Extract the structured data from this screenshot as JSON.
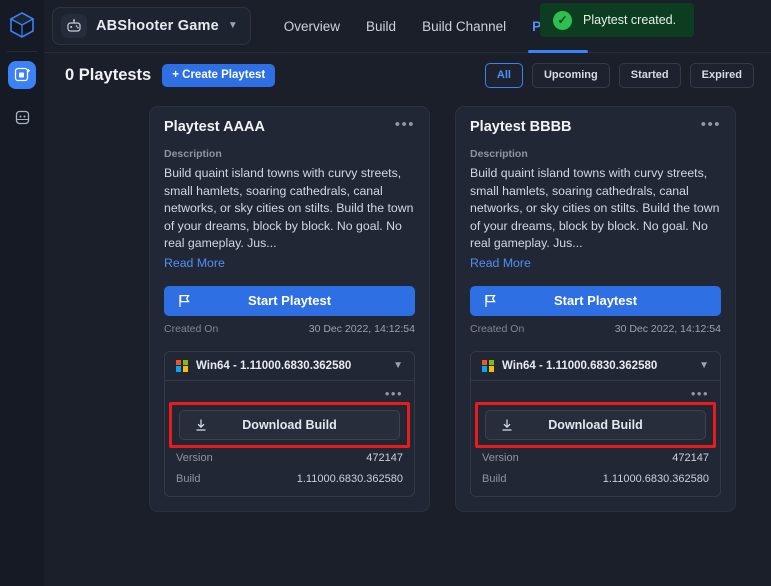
{
  "rail": {
    "logo_icon": "cube-logo-icon",
    "items": [
      {
        "icon": "playtest-icon",
        "active": true
      },
      {
        "icon": "build-archive-icon",
        "active": false
      }
    ]
  },
  "topbar": {
    "game_selector": {
      "icon": "gamepad-icon",
      "name": "ABShooter Game",
      "chevron": "chevron-down-icon"
    },
    "tabs": [
      {
        "label": "Overview",
        "active": false
      },
      {
        "label": "Build",
        "active": false
      },
      {
        "label": "Build Channel",
        "active": false
      },
      {
        "label": "Playtest",
        "active": true
      }
    ]
  },
  "toast": {
    "icon": "check-circle-icon",
    "check_glyph": "✓",
    "message": "Playtest created.",
    "bg_color": "#0d3d20",
    "accent_color": "#2fbf4f"
  },
  "toolbar": {
    "count_label": "0 Playtests",
    "create_label": "+ Create Playtest",
    "filters": [
      {
        "label": "All",
        "active": true
      },
      {
        "label": "Upcoming",
        "active": false
      },
      {
        "label": "Started",
        "active": false
      },
      {
        "label": "Expired",
        "active": false
      }
    ]
  },
  "cards": [
    {
      "title": "Playtest AAAA",
      "menu_icon": "more-options-icon",
      "description_label": "Description",
      "description": "Build quaint island towns with curvy streets, small hamlets, soaring cathedrals, canal networks, or sky cities on stilts. Build the town of your dreams, block by block. No goal. No real gameplay. Jus...",
      "read_more": "Read More",
      "start_label": "Start Playtest",
      "start_icon": "flag-icon",
      "created_label": "Created On",
      "created_value": "30 Dec 2022, 14:12:54",
      "build_name": "Win64 - 1.11000.6830.362580",
      "build_icon": "windows-icon",
      "build_chevron": "chevron-down-icon",
      "build_menu_icon": "more-options-icon",
      "download_label": "Download Build",
      "download_icon": "download-icon",
      "version_label": "Version",
      "version_value": "472147",
      "build_label": "Build",
      "build_value": "1.11000.6830.362580"
    },
    {
      "title": "Playtest BBBB",
      "menu_icon": "more-options-icon",
      "description_label": "Description",
      "description": "Build quaint island towns with curvy streets, small hamlets, soaring cathedrals, canal networks, or sky cities on stilts. Build the town of your dreams, block by block. No goal. No real gameplay. Jus...",
      "read_more": "Read More",
      "start_label": "Start Playtest",
      "start_icon": "flag-icon",
      "created_label": "Created On",
      "created_value": "30 Dec 2022, 14:12:54",
      "build_name": "Win64 - 1.11000.6830.362580",
      "build_icon": "windows-icon",
      "build_chevron": "chevron-down-icon",
      "build_menu_icon": "more-options-icon",
      "download_label": "Download Build",
      "download_icon": "download-icon",
      "version_label": "Version",
      "version_value": "472147",
      "build_label": "Build",
      "build_value": "1.11000.6830.362580"
    }
  ],
  "annotation": {
    "type": "highlight-rectangle",
    "color": "#e81c1c",
    "targets": [
      "download-build-button-card-1",
      "download-build-button-card-2"
    ]
  },
  "colors": {
    "page_bg": "#1b1f2a",
    "card_bg": "#222736",
    "accent_blue": "#3b82f6",
    "primary_button": "#2f6fe4"
  }
}
